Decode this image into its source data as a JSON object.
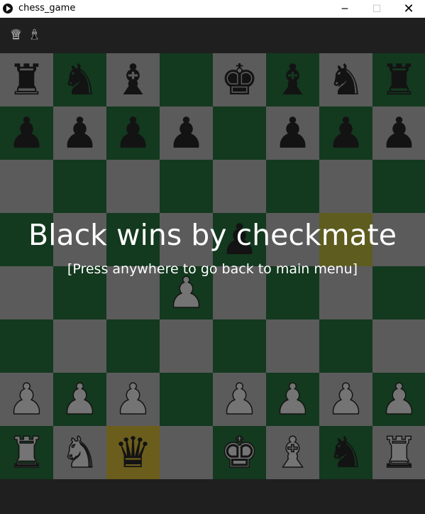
{
  "window": {
    "title": "chess_game",
    "minimize_glyph": "─",
    "maximize_glyph": "☐",
    "close_glyph": "✕"
  },
  "captured": [
    {
      "piece": "queen",
      "color": "white",
      "glyph": "♛"
    },
    {
      "piece": "bishop",
      "color": "white",
      "glyph": "♝"
    }
  ],
  "board": {
    "light_color": "#bdbdbd",
    "dark_color": "#006420",
    "highlight_color": "#c6c01e",
    "rows": [
      [
        {
          "p": "r",
          "c": "b"
        },
        {
          "p": "n",
          "c": "b"
        },
        {
          "p": "b",
          "c": "b"
        },
        null,
        {
          "p": "k",
          "c": "b"
        },
        {
          "p": "b",
          "c": "b"
        },
        {
          "p": "n",
          "c": "b"
        },
        {
          "p": "r",
          "c": "b"
        }
      ],
      [
        {
          "p": "p",
          "c": "b"
        },
        {
          "p": "p",
          "c": "b"
        },
        {
          "p": "p",
          "c": "b"
        },
        {
          "p": "p",
          "c": "b"
        },
        null,
        {
          "p": "p",
          "c": "b"
        },
        {
          "p": "p",
          "c": "b"
        },
        {
          "p": "p",
          "c": "b"
        }
      ],
      [
        null,
        null,
        null,
        null,
        null,
        null,
        null,
        null
      ],
      [
        null,
        null,
        null,
        null,
        {
          "p": "p",
          "c": "b"
        },
        null,
        {
          "hl": true
        },
        null
      ],
      [
        null,
        null,
        null,
        {
          "p": "p",
          "c": "w"
        },
        null,
        null,
        null,
        null
      ],
      [
        null,
        null,
        null,
        null,
        null,
        null,
        null,
        null
      ],
      [
        {
          "p": "p",
          "c": "w"
        },
        {
          "p": "p",
          "c": "w"
        },
        {
          "p": "p",
          "c": "w"
        },
        null,
        {
          "p": "p",
          "c": "w"
        },
        {
          "p": "p",
          "c": "w"
        },
        {
          "p": "p",
          "c": "w"
        },
        {
          "p": "p",
          "c": "w"
        }
      ],
      [
        {
          "p": "r",
          "c": "w"
        },
        {
          "p": "n",
          "c": "w"
        },
        {
          "p": "q",
          "c": "b",
          "hl": true
        },
        null,
        {
          "p": "k",
          "c": "w"
        },
        {
          "p": "b",
          "c": "w"
        },
        {
          "p": "n",
          "c": "b"
        },
        {
          "p": "r",
          "c": "w"
        }
      ]
    ]
  },
  "glyphs": {
    "k": "♚",
    "q": "♛",
    "r": "♜",
    "b": "♝",
    "n": "♞",
    "p": "♟"
  },
  "game_over": {
    "message": "Black wins by checkmate",
    "hint": "[Press anywhere to go back to main menu]"
  }
}
